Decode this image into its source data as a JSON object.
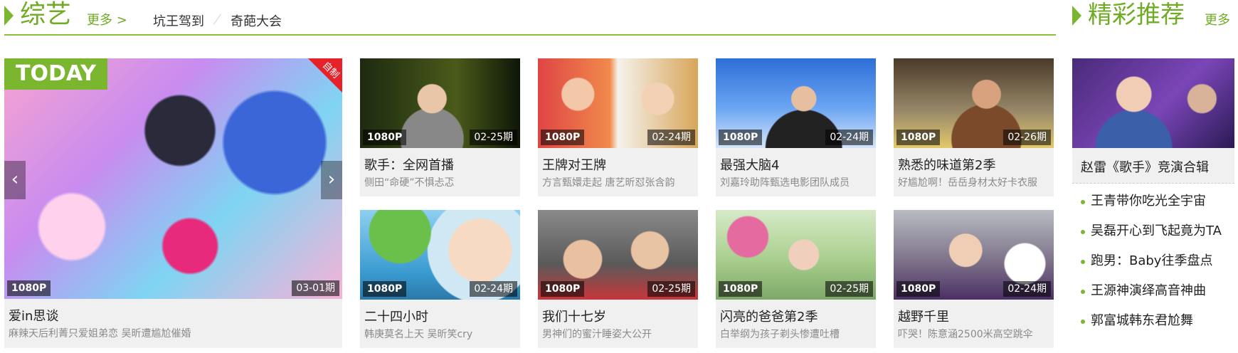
{
  "section": {
    "title": "综艺",
    "more_label": "更多 >",
    "tags": [
      "坑王驾到",
      "奇葩大会"
    ]
  },
  "feature": {
    "today_label": "TODAY",
    "corner_label": "自制",
    "quality": "1080P",
    "period": "03-01期",
    "title": "爱in思谈",
    "subtitle": "麻辣天后利菁只爱姐弟恋 吴昕遭尴尬催婚"
  },
  "cards": [
    {
      "quality": "1080P",
      "period": "02-25期",
      "title": "歌手：全网首播",
      "subtitle": "侧田“命硬”不惧忐忑"
    },
    {
      "quality": "1080P",
      "period": "02-24期",
      "title": "王牌对王牌",
      "subtitle": "方言甄嬛走起 唐艺昕怼张含韵"
    },
    {
      "quality": "1080P",
      "period": "02-24期",
      "title": "最强大脑4",
      "subtitle": "刘嘉玲助阵甄选电影团队成员"
    },
    {
      "quality": "1080P",
      "period": "02-26期",
      "title": "熟悉的味道第2季",
      "subtitle": "好尴尬啊！岳岳身材太好卡衣服"
    },
    {
      "quality": "1080P",
      "period": "02-24期",
      "title": "二十四小时",
      "subtitle": "韩庚莫名上天 吴昕笑cry"
    },
    {
      "quality": "1080P",
      "period": "02-25期",
      "title": "我们十七岁",
      "subtitle": "男神们的蜜汁睡姿大公开"
    },
    {
      "quality": "1080P",
      "period": "02-25期",
      "title": "闪亮的爸爸第2季",
      "subtitle": "白举纲为孩子剃头惨遭吐槽"
    },
    {
      "quality": "1080P",
      "period": "02-24期",
      "title": "越野千里",
      "subtitle": "吓哭！陈意涵2500米高空跳伞"
    }
  ],
  "recommend": {
    "title": "精彩推荐",
    "more_label": "更多",
    "featured_title": "赵雷《歌手》竞演合辑",
    "items": [
      "王青带你吃光全宇宙",
      "吴磊开心到飞起竟为TA",
      "跑男：Baby往季盘点",
      "王源神演绎高音神曲",
      "郭富城韩东君尬舞"
    ]
  }
}
